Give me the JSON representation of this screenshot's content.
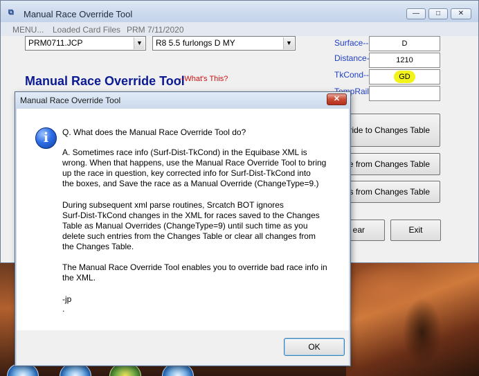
{
  "main_window": {
    "title": "Manual Race Override Tool",
    "app_icon_glyph": "⧉",
    "caption_buttons": {
      "minimize": "—",
      "maximize": "□",
      "close": "✕"
    },
    "menu": [
      "MENU...",
      "Loaded Card Files",
      "PRM 7/11/2020"
    ],
    "card_file_combo": "PRM0711.JCP",
    "race_combo": "R8 5.5 furlongs D MY",
    "tool_title": "Manual Race Override Tool",
    "whats_this": "--What's This?",
    "fields": {
      "surface_label": "Surface---",
      "surface_value": "D",
      "distance_label": "Distance---",
      "distance_value": "1210",
      "tkcond_label": "TkCond---",
      "tkcond_value": "GD",
      "temprail_label": "TempRail-"
    },
    "buttons": {
      "save_override": "rride to Changes Table",
      "delete_override": "de from Changes Table",
      "clear_changes": "es from Changes Table",
      "clear": "ear",
      "exit": "Exit"
    }
  },
  "dialog": {
    "title": "Manual Race Override Tool",
    "close_glyph": "✕",
    "icon_glyph": "i",
    "question": "Q. What does the Manual Race Override Tool do?",
    "para1": [
      "A. Sometimes race info (Surf-Dist-TkCond) in the Equibase XML is",
      "wrong. When that happens, use the Manual Race Override Tool to bring",
      "up the race in question, key corrected info for  Surf-Dist-TkCond into",
      "the boxes, and Save the race as a Manual Override (ChangeType=9.)"
    ],
    "para2": [
      "During subsequent xml parse routines, Srcatch BOT ignores",
      "Surf-Dist-TkCond changes in the XML for races saved to the Changes",
      "Table as Manual Overrides (ChangeType=9) until such time as you",
      "delete such entries from the Changes Table or clear all changes from",
      "the Changes Table."
    ],
    "para3": [
      "The Manual Race Override Tool enables you to override bad race info in",
      "the XML."
    ],
    "signature": "-jp",
    "trailing": ".",
    "ok_label": "OK"
  }
}
